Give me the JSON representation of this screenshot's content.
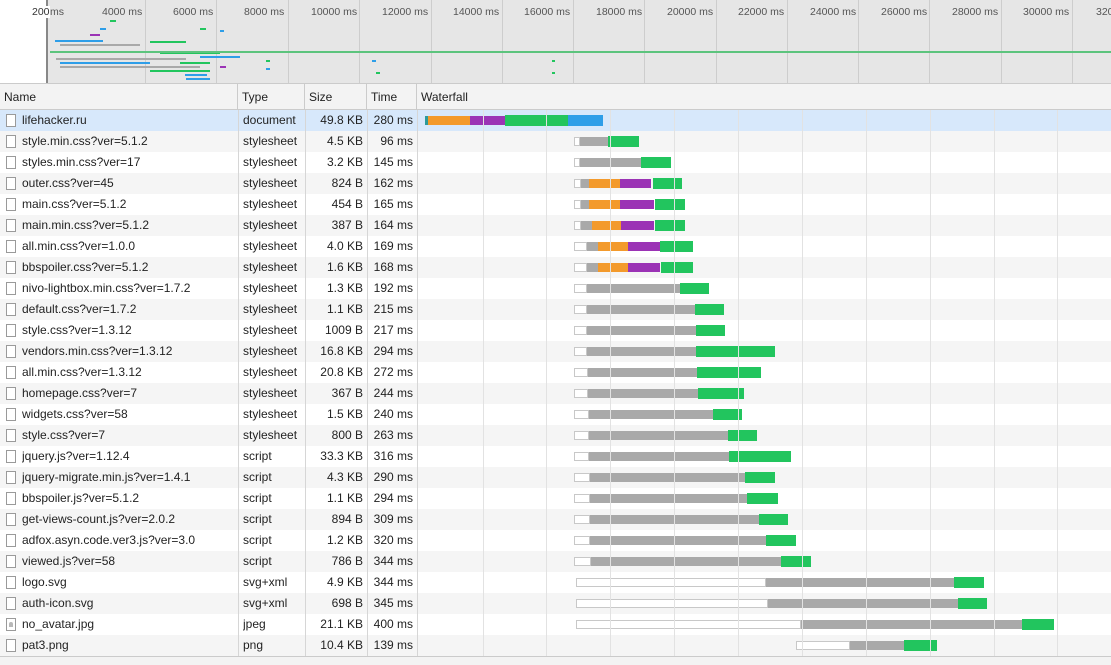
{
  "overview": {
    "handle_label": "200",
    "ticks": [
      "ms",
      "4000 ms",
      "6000 ms",
      "8000 ms",
      "10000 ms",
      "12000 ms",
      "14000 ms",
      "16000 ms",
      "18000 ms",
      "20000 ms",
      "22000 ms",
      "24000 ms",
      "26000 ms",
      "28000 ms",
      "30000 ms",
      "320"
    ]
  },
  "columns": {
    "name": "Name",
    "type": "Type",
    "size": "Size",
    "time": "Time",
    "waterfall": "Waterfall"
  },
  "colors": {
    "queue": "#ffffff",
    "stall": "#a9a9a9",
    "dns": "#2c9b9b",
    "connect": "#f39a2c",
    "ssl": "#9b33b5",
    "waiting": "#22c55e",
    "download": "#2e9ee8",
    "selected_row": "#d7e8fb"
  },
  "rows": [
    {
      "name": "lifehacker.ru",
      "type": "document",
      "size": "49.8 KB",
      "time": "280 ms",
      "icon": "document-icon",
      "selected": true
    },
    {
      "name": "style.min.css?ver=5.1.2",
      "type": "stylesheet",
      "size": "4.5 KB",
      "time": "96 ms",
      "icon": "document-icon"
    },
    {
      "name": "styles.min.css?ver=17",
      "type": "stylesheet",
      "size": "3.2 KB",
      "time": "145 ms",
      "icon": "document-icon"
    },
    {
      "name": "outer.css?ver=45",
      "type": "stylesheet",
      "size": "824 B",
      "time": "162 ms",
      "icon": "document-icon"
    },
    {
      "name": "main.css?ver=5.1.2",
      "type": "stylesheet",
      "size": "454 B",
      "time": "165 ms",
      "icon": "document-icon"
    },
    {
      "name": "main.min.css?ver=5.1.2",
      "type": "stylesheet",
      "size": "387 B",
      "time": "164 ms",
      "icon": "document-icon"
    },
    {
      "name": "all.min.css?ver=1.0.0",
      "type": "stylesheet",
      "size": "4.0 KB",
      "time": "169 ms",
      "icon": "document-icon"
    },
    {
      "name": "bbspoiler.css?ver=5.1.2",
      "type": "stylesheet",
      "size": "1.6 KB",
      "time": "168 ms",
      "icon": "document-icon"
    },
    {
      "name": "nivo-lightbox.min.css?ver=1.7.2",
      "type": "stylesheet",
      "size": "1.3 KB",
      "time": "192 ms",
      "icon": "document-icon"
    },
    {
      "name": "default.css?ver=1.7.2",
      "type": "stylesheet",
      "size": "1.1 KB",
      "time": "215 ms",
      "icon": "document-icon"
    },
    {
      "name": "style.css?ver=1.3.12",
      "type": "stylesheet",
      "size": "1009 B",
      "time": "217 ms",
      "icon": "document-icon"
    },
    {
      "name": "vendors.min.css?ver=1.3.12",
      "type": "stylesheet",
      "size": "16.8 KB",
      "time": "294 ms",
      "icon": "document-icon"
    },
    {
      "name": "all.min.css?ver=1.3.12",
      "type": "stylesheet",
      "size": "20.8 KB",
      "time": "272 ms",
      "icon": "document-icon"
    },
    {
      "name": "homepage.css?ver=7",
      "type": "stylesheet",
      "size": "367 B",
      "time": "244 ms",
      "icon": "document-icon"
    },
    {
      "name": "widgets.css?ver=58",
      "type": "stylesheet",
      "size": "1.5 KB",
      "time": "240 ms",
      "icon": "document-icon"
    },
    {
      "name": "style.css?ver=7",
      "type": "stylesheet",
      "size": "800 B",
      "time": "263 ms",
      "icon": "document-icon"
    },
    {
      "name": "jquery.js?ver=1.12.4",
      "type": "script",
      "size": "33.3 KB",
      "time": "316 ms",
      "icon": "document-icon"
    },
    {
      "name": "jquery-migrate.min.js?ver=1.4.1",
      "type": "script",
      "size": "4.3 KB",
      "time": "290 ms",
      "icon": "document-icon"
    },
    {
      "name": "bbspoiler.js?ver=5.1.2",
      "type": "script",
      "size": "1.1 KB",
      "time": "294 ms",
      "icon": "document-icon"
    },
    {
      "name": "get-views-count.js?ver=2.0.2",
      "type": "script",
      "size": "894 B",
      "time": "309 ms",
      "icon": "document-icon"
    },
    {
      "name": "adfox.asyn.code.ver3.js?ver=3.0",
      "type": "script",
      "size": "1.2 KB",
      "time": "320 ms",
      "icon": "document-icon"
    },
    {
      "name": "viewed.js?ver=58",
      "type": "script",
      "size": "786 B",
      "time": "344 ms",
      "icon": "document-icon"
    },
    {
      "name": "logo.svg",
      "type": "svg+xml",
      "size": "4.9 KB",
      "time": "344 ms",
      "icon": "document-icon"
    },
    {
      "name": "auth-icon.svg",
      "type": "svg+xml",
      "size": "698 B",
      "time": "345 ms",
      "icon": "document-icon"
    },
    {
      "name": "no_avatar.jpg",
      "type": "jpeg",
      "size": "21.1 KB",
      "time": "400 ms",
      "icon": "image-icon"
    },
    {
      "name": "pat3.png",
      "type": "png",
      "size": "10.4 KB",
      "time": "139 ms",
      "icon": "document-icon"
    }
  ]
}
